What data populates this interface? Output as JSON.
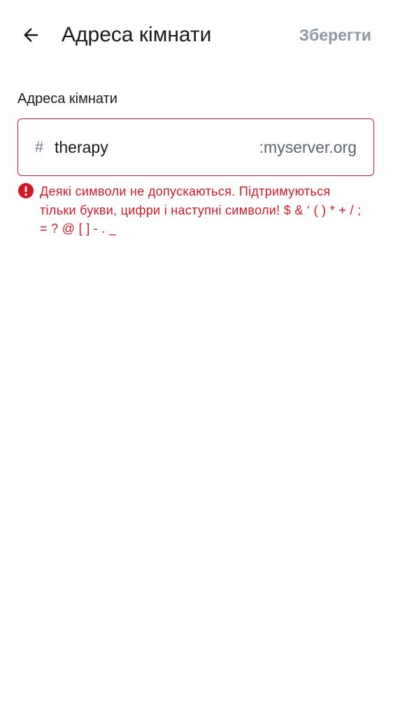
{
  "header": {
    "title": "Адреса кімнати",
    "save_label": "Зберегти"
  },
  "form": {
    "label": "Адреса кімнати",
    "prefix": "#",
    "alias_value": "therapy",
    "server_suffix": ":myserver.org",
    "error_message": "Деякі символи не допускаються. Підтримуються тільки букви, цифри і наступні символи! $ & ‘ ( ) * + / ; = ? @ [ ] - . _"
  },
  "colors": {
    "error": "#d51928",
    "text_primary": "#17191c",
    "text_secondary": "#737d8c",
    "save_disabled": "#8d97a5"
  },
  "icons": {
    "back": "arrow-left-icon",
    "error": "exclamation-circle-icon"
  }
}
